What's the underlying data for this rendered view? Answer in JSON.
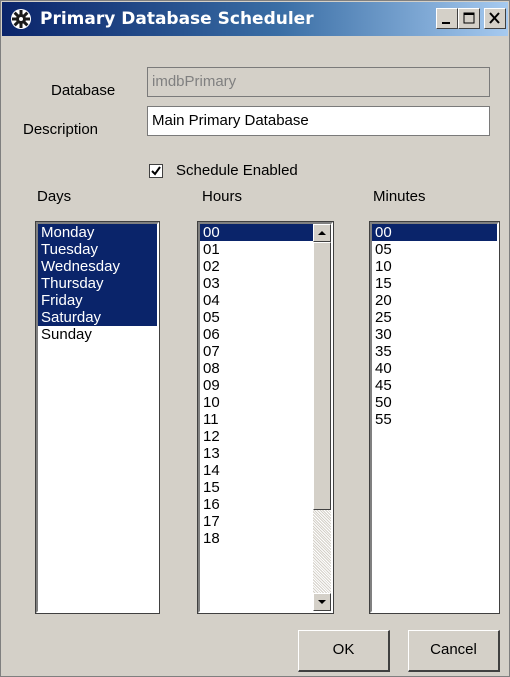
{
  "window": {
    "title": "Primary Database Scheduler",
    "app_icon": "gear-icon"
  },
  "form": {
    "database_label": "Database",
    "database_value": "imdbPrimary",
    "description_label": "Description",
    "description_value": "Main Primary Database",
    "schedule_enabled_label": "Schedule Enabled",
    "schedule_enabled": true
  },
  "days": {
    "header": "Days",
    "items": [
      {
        "label": "Monday",
        "selected": true
      },
      {
        "label": "Tuesday",
        "selected": true
      },
      {
        "label": "Wednesday",
        "selected": true
      },
      {
        "label": "Thursday",
        "selected": true
      },
      {
        "label": "Friday",
        "selected": true
      },
      {
        "label": "Saturday",
        "selected": true
      },
      {
        "label": "Sunday",
        "selected": false
      }
    ]
  },
  "hours": {
    "header": "Hours",
    "items": [
      {
        "label": "00",
        "selected": true
      },
      {
        "label": "01",
        "selected": false
      },
      {
        "label": "02",
        "selected": false
      },
      {
        "label": "03",
        "selected": false
      },
      {
        "label": "04",
        "selected": false
      },
      {
        "label": "05",
        "selected": false
      },
      {
        "label": "06",
        "selected": false
      },
      {
        "label": "07",
        "selected": false
      },
      {
        "label": "08",
        "selected": false
      },
      {
        "label": "09",
        "selected": false
      },
      {
        "label": "10",
        "selected": false
      },
      {
        "label": "11",
        "selected": false
      },
      {
        "label": "12",
        "selected": false
      },
      {
        "label": "13",
        "selected": false
      },
      {
        "label": "14",
        "selected": false
      },
      {
        "label": "15",
        "selected": false
      },
      {
        "label": "16",
        "selected": false
      },
      {
        "label": "17",
        "selected": false
      },
      {
        "label": "18",
        "selected": false
      }
    ]
  },
  "minutes": {
    "header": "Minutes",
    "items": [
      {
        "label": "00",
        "selected": true
      },
      {
        "label": "05",
        "selected": false
      },
      {
        "label": "10",
        "selected": false
      },
      {
        "label": "15",
        "selected": false
      },
      {
        "label": "20",
        "selected": false
      },
      {
        "label": "25",
        "selected": false
      },
      {
        "label": "30",
        "selected": false
      },
      {
        "label": "35",
        "selected": false
      },
      {
        "label": "40",
        "selected": false
      },
      {
        "label": "45",
        "selected": false
      },
      {
        "label": "50",
        "selected": false
      },
      {
        "label": "55",
        "selected": false
      }
    ]
  },
  "buttons": {
    "ok_label": "OK",
    "cancel_label": "Cancel"
  },
  "colors": {
    "selection": "#0a246a",
    "face": "#d4d0c8"
  }
}
